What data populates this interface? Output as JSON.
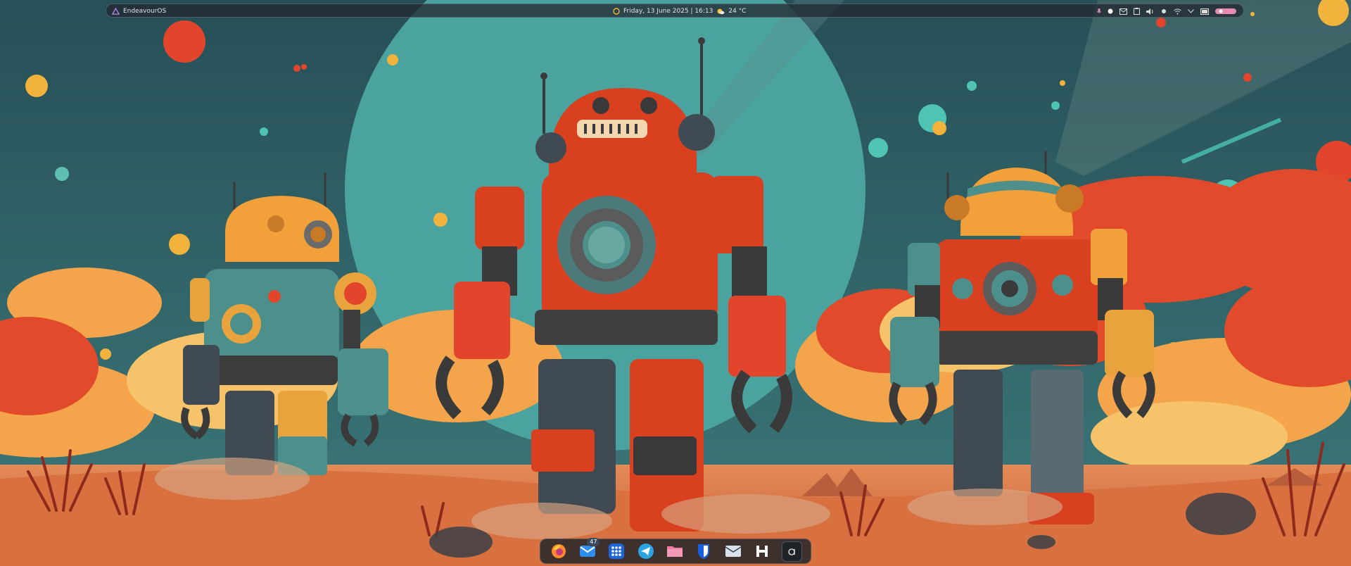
{
  "topbar": {
    "os_label": "EndeavourOS",
    "datetime": "Friday, 13 June 2025 | 16:13",
    "weather": "24 °C"
  },
  "tray": [
    "microphone-icon",
    "record-dot-icon",
    "mail-icon",
    "clipboard-icon",
    "volume-icon",
    "brightness-icon",
    "wifi-icon",
    "chevron-down-icon",
    "battery-icon",
    "power-toggle-icon"
  ],
  "dock": {
    "items": [
      {
        "name": "firefox",
        "icon": "firefox-icon"
      },
      {
        "name": "mail",
        "icon": "mail-icon",
        "badge": "47"
      },
      {
        "name": "app-grid",
        "icon": "app-grid-icon"
      },
      {
        "name": "telegram",
        "icon": "telegram-icon"
      },
      {
        "name": "files",
        "icon": "folder-icon"
      },
      {
        "name": "bitwarden",
        "icon": "shield-icon"
      },
      {
        "name": "mail-client",
        "icon": "envelope-icon"
      },
      {
        "name": "hub",
        "icon": "h-letter-icon"
      },
      {
        "name": "terminal",
        "icon": "a-letter-icon"
      }
    ]
  },
  "colors": {
    "sky": "#2c5a60",
    "planet": "#4fa7a3",
    "cloud_orange": "#f2a04a",
    "cloud_red": "#e0452c",
    "ground": "#d56a3f",
    "robot_red": "#d8401f",
    "robot_orange": "#f1a03a",
    "robot_teal": "#4c8f8b"
  }
}
